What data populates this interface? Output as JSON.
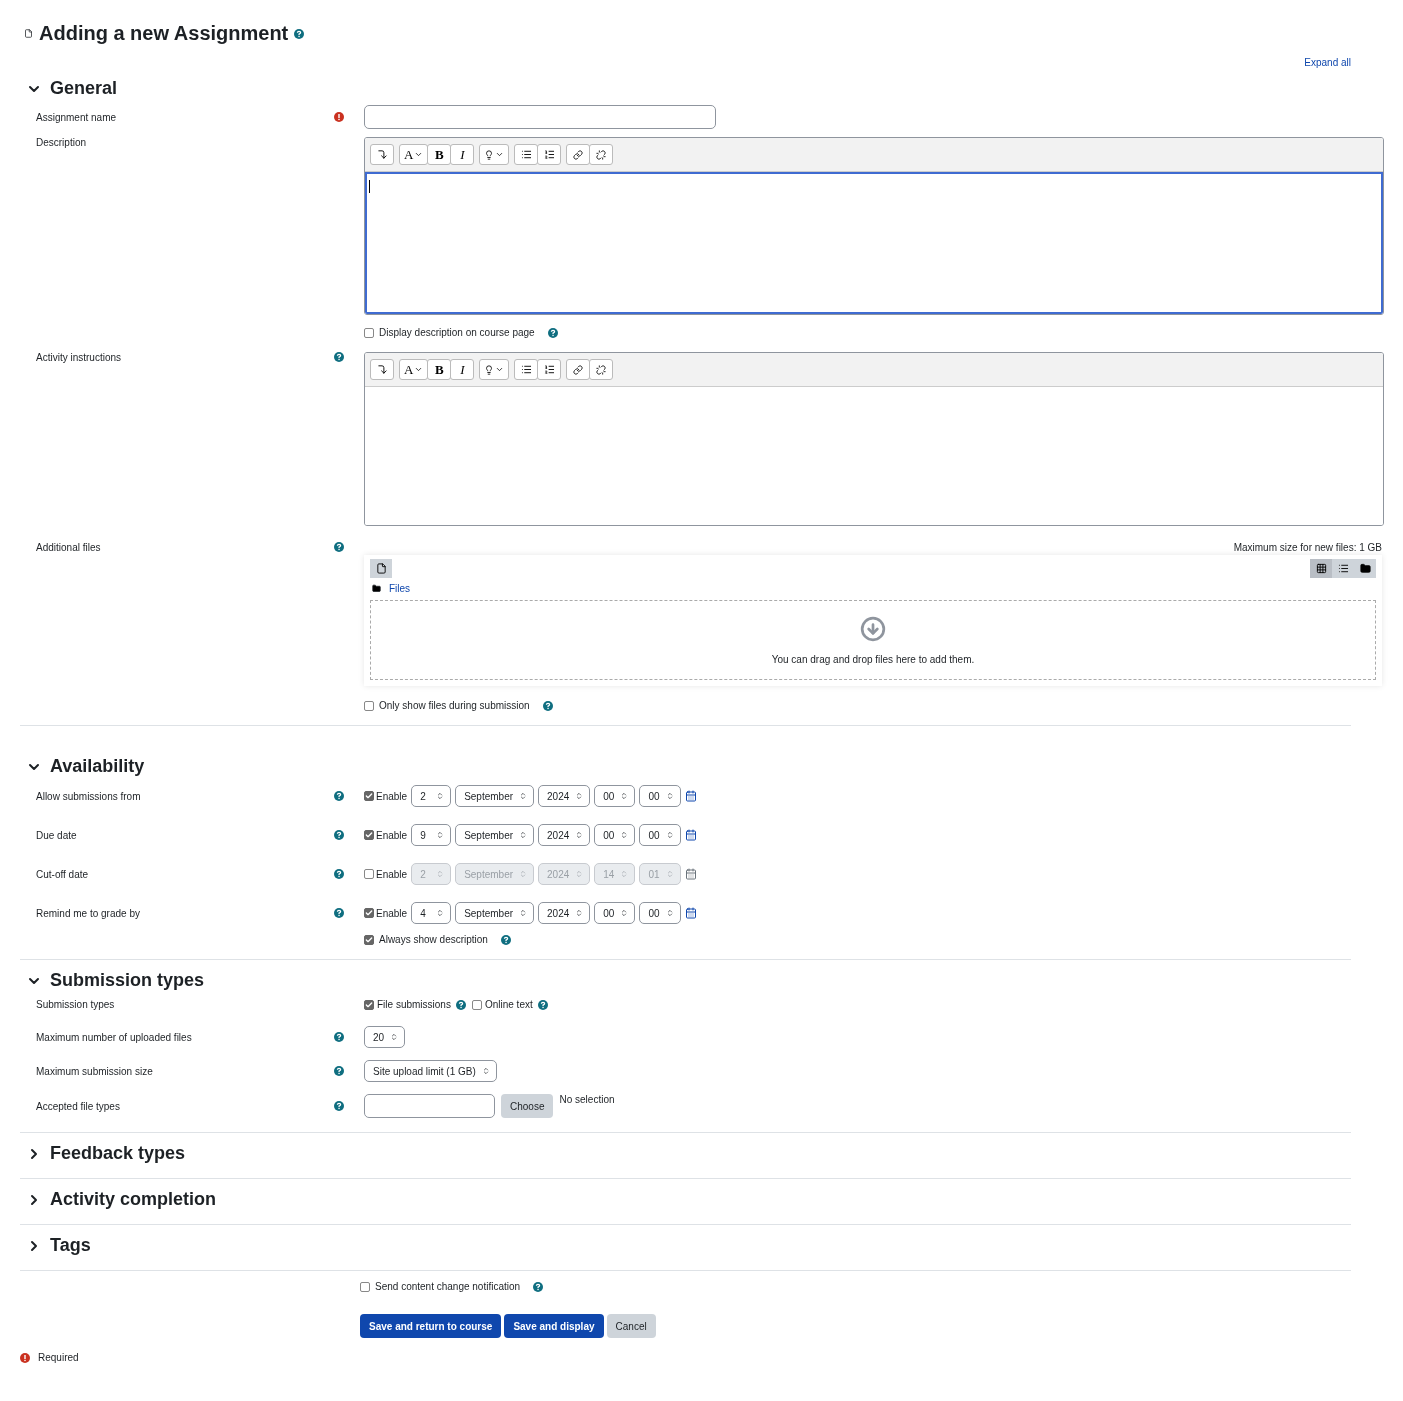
{
  "page": {
    "title": "Adding a new Assignment",
    "expand_all": "Expand all"
  },
  "general": {
    "title": "General",
    "expanded": true,
    "assignment_name": {
      "label": "Assignment name",
      "required": true
    },
    "description": {
      "label": "Description",
      "focused": true,
      "toolbar": {
        "font": "A",
        "bold": "B",
        "italic": "I"
      },
      "display_on_page": {
        "label": "Display description on course page",
        "checked": false
      }
    },
    "activity_instructions": {
      "label": "Activity instructions",
      "focused": false,
      "toolbar": {
        "font": "A",
        "bold": "B",
        "italic": "I"
      }
    },
    "additional_files": {
      "label": "Additional files",
      "max_size": "Maximum size for new files: 1 GB",
      "path": "Files",
      "drop_hint": "You can drag and drop files here to add them.",
      "views": [
        {
          "kind": "icons",
          "selected": true
        },
        {
          "kind": "list",
          "selected": false
        },
        {
          "kind": "tree",
          "selected": false
        }
      ],
      "only_show": {
        "label": "Only show files during submission",
        "checked": false
      }
    }
  },
  "availability": {
    "title": "Availability",
    "expanded": true,
    "dates": [
      {
        "label": "Allow submissions from",
        "enable": "Enable",
        "enabled": true,
        "day": "2",
        "month": "September",
        "year": "2024",
        "hour": "00",
        "minute": "00"
      },
      {
        "label": "Due date",
        "enable": "Enable",
        "enabled": true,
        "day": "9",
        "month": "September",
        "year": "2024",
        "hour": "00",
        "minute": "00"
      },
      {
        "label": "Cut-off date",
        "enable": "Enable",
        "enabled": false,
        "day": "2",
        "month": "September",
        "year": "2024",
        "hour": "14",
        "minute": "01"
      },
      {
        "label": "Remind me to grade by",
        "enable": "Enable",
        "enabled": true,
        "day": "4",
        "month": "September",
        "year": "2024",
        "hour": "00",
        "minute": "00"
      }
    ],
    "always_show": {
      "label": "Always show description",
      "checked": true
    }
  },
  "submission_types": {
    "title": "Submission types",
    "expanded": true,
    "types_label": "Submission types",
    "types": [
      {
        "label": "File submissions",
        "checked": true
      },
      {
        "label": "Online text",
        "checked": false
      }
    ],
    "max_files": {
      "label": "Maximum number of uploaded files",
      "value": "20"
    },
    "max_size": {
      "label": "Maximum submission size",
      "value": "Site upload limit (1 GB)"
    },
    "accepted": {
      "label": "Accepted file types",
      "button": "Choose",
      "status": "No selection"
    }
  },
  "collapsed_sections": [
    {
      "title": "Feedback types",
      "expanded": false
    },
    {
      "title": "Activity completion",
      "expanded": false
    },
    {
      "title": "Tags",
      "expanded": false
    }
  ],
  "footer": {
    "notify": {
      "label": "Send content change notification",
      "checked": false
    },
    "buttons": [
      {
        "label": "Save and return to course",
        "kind": "primary"
      },
      {
        "label": "Save and display",
        "kind": "primary"
      },
      {
        "label": "Cancel",
        "kind": "secondary"
      }
    ],
    "required": "Required"
  }
}
